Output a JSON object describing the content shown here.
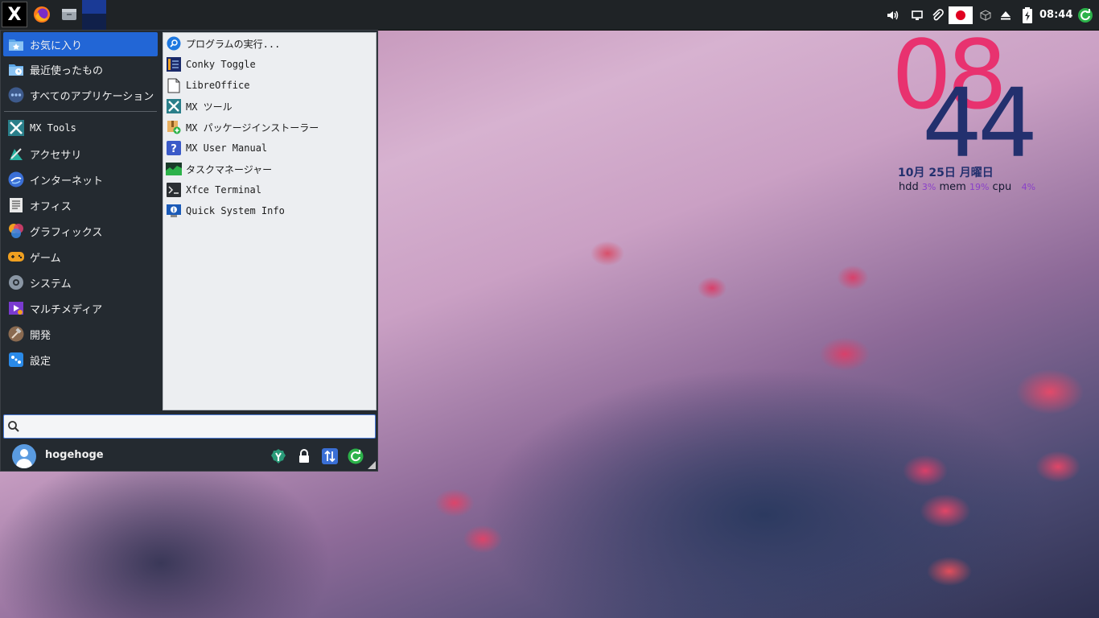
{
  "panel": {
    "clock": "08:44",
    "launchers": [
      "mx-logo",
      "firefox-icon",
      "file-manager-icon"
    ],
    "tray_icons": [
      "volume-icon",
      "display-icon",
      "clipboard-icon",
      "japanese-input-icon",
      "disk-icon",
      "eject-icon",
      "battery-charging-icon",
      "updater-icon"
    ]
  },
  "menu": {
    "categories": [
      {
        "label": "お気に入り",
        "icon": "favorites-folder-icon"
      },
      {
        "label": "最近使ったもの",
        "icon": "recent-folder-icon"
      },
      {
        "label": "すべてのアプリケーション",
        "icon": "all-apps-icon"
      },
      {
        "label": "MX Tools",
        "icon": "mx-tools-icon"
      },
      {
        "label": "アクセサリ",
        "icon": "accessories-icon"
      },
      {
        "label": "インターネット",
        "icon": "internet-icon"
      },
      {
        "label": "オフィス",
        "icon": "office-icon"
      },
      {
        "label": "グラフィックス",
        "icon": "graphics-icon"
      },
      {
        "label": "ゲーム",
        "icon": "games-icon"
      },
      {
        "label": "システム",
        "icon": "system-icon"
      },
      {
        "label": "マルチメディア",
        "icon": "multimedia-icon"
      },
      {
        "label": "開発",
        "icon": "development-icon"
      },
      {
        "label": "設定",
        "icon": "settings-icon"
      }
    ],
    "apps": [
      {
        "label": "プログラムの実行...",
        "icon": "run-program-icon"
      },
      {
        "label": "Conky Toggle",
        "icon": "conky-icon"
      },
      {
        "label": "LibreOffice",
        "icon": "libreoffice-icon"
      },
      {
        "label": "MX ツール",
        "icon": "mx-tools-icon"
      },
      {
        "label": "MX パッケージインストーラー",
        "icon": "package-installer-icon"
      },
      {
        "label": "MX User Manual",
        "icon": "help-icon"
      },
      {
        "label": "タスクマネージャー",
        "icon": "task-manager-icon"
      },
      {
        "label": "Xfce Terminal",
        "icon": "terminal-icon"
      },
      {
        "label": "Quick System Info",
        "icon": "system-info-icon"
      }
    ],
    "search": {
      "value": "",
      "placeholder": ""
    },
    "user": {
      "name": "hogehoge"
    },
    "actions": [
      "settings-manager-icon",
      "lock-icon",
      "switch-user-icon",
      "logout-icon"
    ]
  },
  "conky": {
    "hour": "08",
    "minute": "44",
    "date": "10月 25日 月曜日",
    "hdd_label": "hdd",
    "hdd_value": "3%",
    "mem_label": "mem",
    "mem_value": "19%",
    "cpu_label": "cpu",
    "cpu_value": "4%"
  },
  "colors": {
    "panel_bg": "#1f2326",
    "menu_bg": "#242a30",
    "selection": "#2266d6",
    "conky_hour": "#e8326f",
    "conky_minute": "#23306e"
  }
}
